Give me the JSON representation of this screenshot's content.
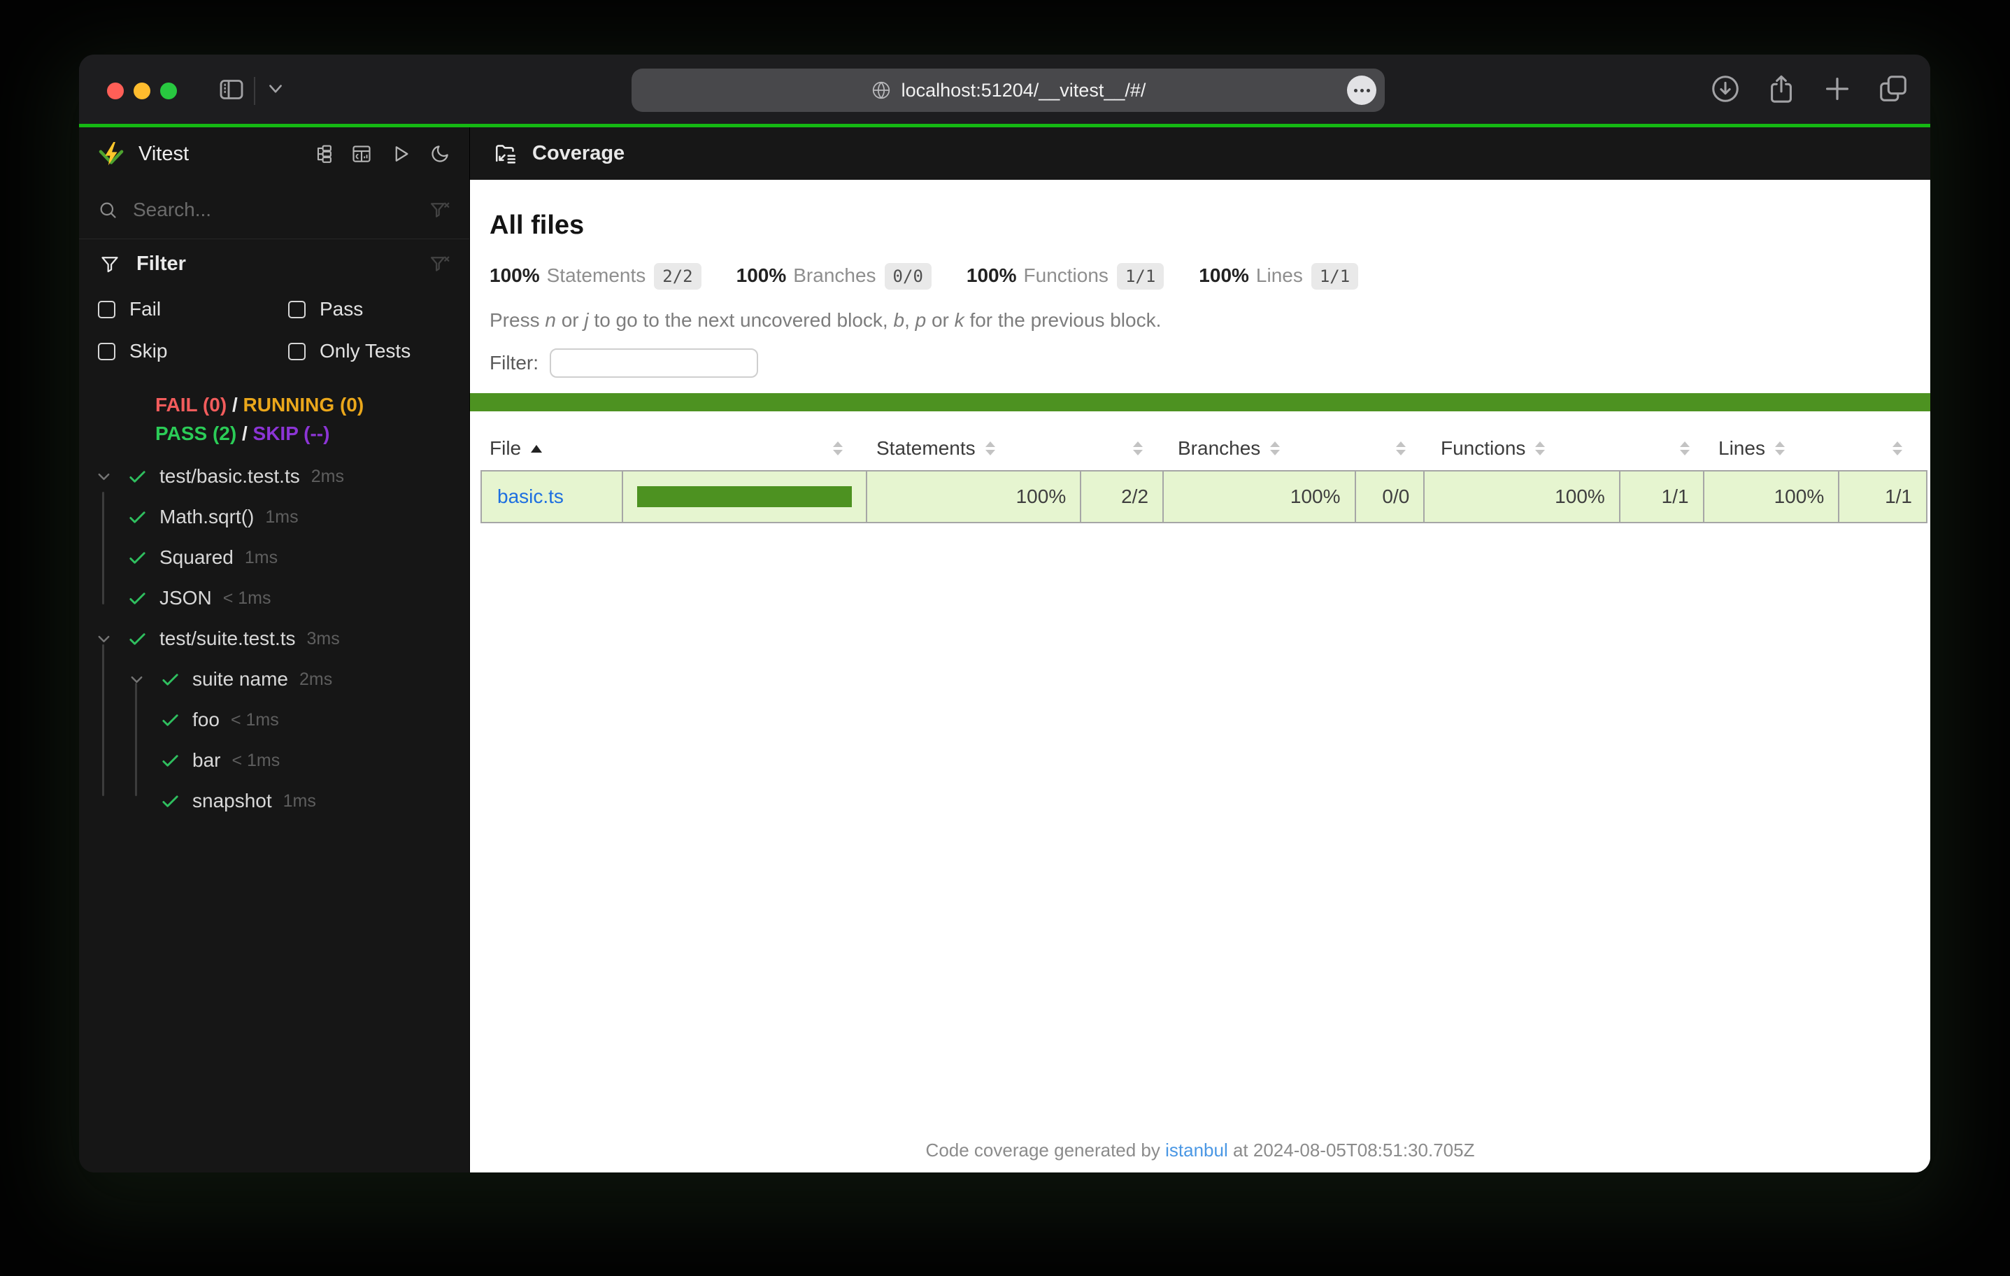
{
  "browser": {
    "url": "localhost:51204/__vitest__/#/",
    "window_controls": [
      "close",
      "minimize",
      "zoom"
    ],
    "toolbar_icons": [
      "sidebar-toggle-icon",
      "tab-chevron-icon",
      "globe-icon",
      "page-menu-icon",
      "downloads-icon",
      "share-icon",
      "new-tab-icon",
      "tab-overview-icon"
    ]
  },
  "sidebar": {
    "app_name": "Vitest",
    "header_icons": [
      "tree-view-icon",
      "dashboard-icon",
      "run-all-icon",
      "dark-mode-icon"
    ],
    "search_placeholder": "Search...",
    "search_icons": [
      "search-icon",
      "clear-search-filter-icon"
    ],
    "filter": {
      "title": "Filter",
      "icons": [
        "filter-icon",
        "clear-filter-icon"
      ],
      "checkboxes": [
        {
          "label": "Fail",
          "checked": false
        },
        {
          "label": "Pass",
          "checked": false
        },
        {
          "label": "Skip",
          "checked": false
        },
        {
          "label": "Only Tests",
          "checked": false
        }
      ]
    },
    "status": {
      "fail": "FAIL (0)",
      "running": "RUNNING (0)",
      "pass": "PASS (2)",
      "skip": "SKIP (--)",
      "separator": "/"
    },
    "tree": [
      {
        "label": "test/basic.test.ts",
        "duration": "2ms",
        "level": 0,
        "expandable": true,
        "state": "pass"
      },
      {
        "label": "Math.sqrt()",
        "duration": "1ms",
        "level": 1,
        "expandable": false,
        "state": "pass"
      },
      {
        "label": "Squared",
        "duration": "1ms",
        "level": 1,
        "expandable": false,
        "state": "pass"
      },
      {
        "label": "JSON",
        "duration": "< 1ms",
        "level": 1,
        "expandable": false,
        "state": "pass"
      },
      {
        "label": "test/suite.test.ts",
        "duration": "3ms",
        "level": 0,
        "expandable": true,
        "state": "pass"
      },
      {
        "label": "suite name",
        "duration": "2ms",
        "level": 1,
        "expandable": true,
        "state": "pass"
      },
      {
        "label": "foo",
        "duration": "< 1ms",
        "level": 2,
        "expandable": false,
        "state": "pass"
      },
      {
        "label": "bar",
        "duration": "< 1ms",
        "level": 2,
        "expandable": false,
        "state": "pass"
      },
      {
        "label": "snapshot",
        "duration": "1ms",
        "level": 2,
        "expandable": false,
        "state": "pass"
      }
    ]
  },
  "main": {
    "nav_title": "Coverage",
    "nav_icon": "coverage-report-icon",
    "heading": "All files",
    "metrics": [
      {
        "pct": "100%",
        "label": "Statements",
        "ratio": "2/2"
      },
      {
        "pct": "100%",
        "label": "Branches",
        "ratio": "0/0"
      },
      {
        "pct": "100%",
        "label": "Functions",
        "ratio": "1/1"
      },
      {
        "pct": "100%",
        "label": "Lines",
        "ratio": "1/1"
      }
    ],
    "hint_segments": [
      {
        "text": "Press "
      },
      {
        "text": "n",
        "italic": true
      },
      {
        "text": " or "
      },
      {
        "text": "j",
        "italic": true
      },
      {
        "text": " to go to the next uncovered block, "
      },
      {
        "text": "b",
        "italic": true
      },
      {
        "text": ", "
      },
      {
        "text": "p",
        "italic": true
      },
      {
        "text": " or "
      },
      {
        "text": "k",
        "italic": true
      },
      {
        "text": " for the previous block."
      }
    ],
    "filter_label": "Filter:",
    "filter_value": "",
    "table": {
      "columns": [
        "File",
        "Statements",
        "Branches",
        "Functions",
        "Lines"
      ],
      "sort": {
        "column": "File",
        "direction": "asc"
      },
      "rows": [
        {
          "file": "basic.ts",
          "bar_percent": 100,
          "statements_pct": "100%",
          "statements_ratio": "2/2",
          "branches_pct": "100%",
          "branches_ratio": "0/0",
          "functions_pct": "100%",
          "functions_ratio": "1/1",
          "lines_pct": "100%",
          "lines_ratio": "1/1"
        }
      ]
    },
    "footer": {
      "prefix": "Code coverage generated by ",
      "tool": "istanbul",
      "suffix": " at 2024-08-05T08:51:30.705Z"
    }
  },
  "colors": {
    "accent_green": "#15b813",
    "status_fail": "#f25c5c",
    "status_running": "#eaa71b",
    "status_pass": "#2bcc57",
    "status_skip": "#8c35d5",
    "status_separator": "#e8e8e8",
    "check_green": "#2fbf5f",
    "coverage_high_bg": "#e6f5d0",
    "coverage_bar_fill": "#4d9221",
    "status_line_green": "#4d9221",
    "file_link_blue": "#1e6fe0",
    "footer_link_blue": "#4a97e4",
    "traffic_red": "#ff5f57",
    "traffic_yellow": "#febc2e",
    "traffic_green": "#28c840"
  }
}
